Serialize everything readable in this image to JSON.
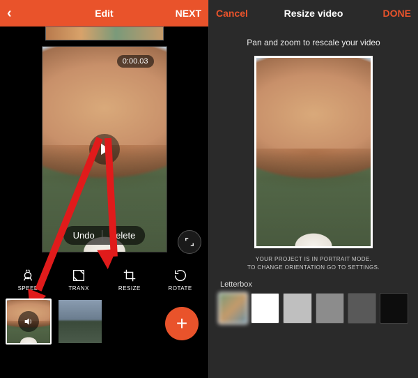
{
  "left": {
    "header": {
      "title": "Edit",
      "next": "NEXT"
    },
    "timecode": "0:00.03",
    "actions": {
      "undo": "Undo",
      "delete": "Delete"
    },
    "tools": [
      {
        "id": "speed",
        "label": "SPEED"
      },
      {
        "id": "tranx",
        "label": "TRANX"
      },
      {
        "id": "resize",
        "label": "RESIZE"
      },
      {
        "id": "rotate",
        "label": "ROTATE"
      }
    ]
  },
  "right": {
    "header": {
      "cancel": "Cancel",
      "title": "Resize video",
      "done": "DONE"
    },
    "hint": "Pan and zoom to rescale your video",
    "note1": "YOUR PROJECT IS IN PORTRAIT MODE.",
    "note2": "TO CHANGE ORIENTATION GO TO SETTINGS.",
    "letterbox_label": "Letterbox",
    "swatches": [
      "blur",
      "white",
      "g1",
      "g2",
      "g3",
      "g4"
    ]
  }
}
